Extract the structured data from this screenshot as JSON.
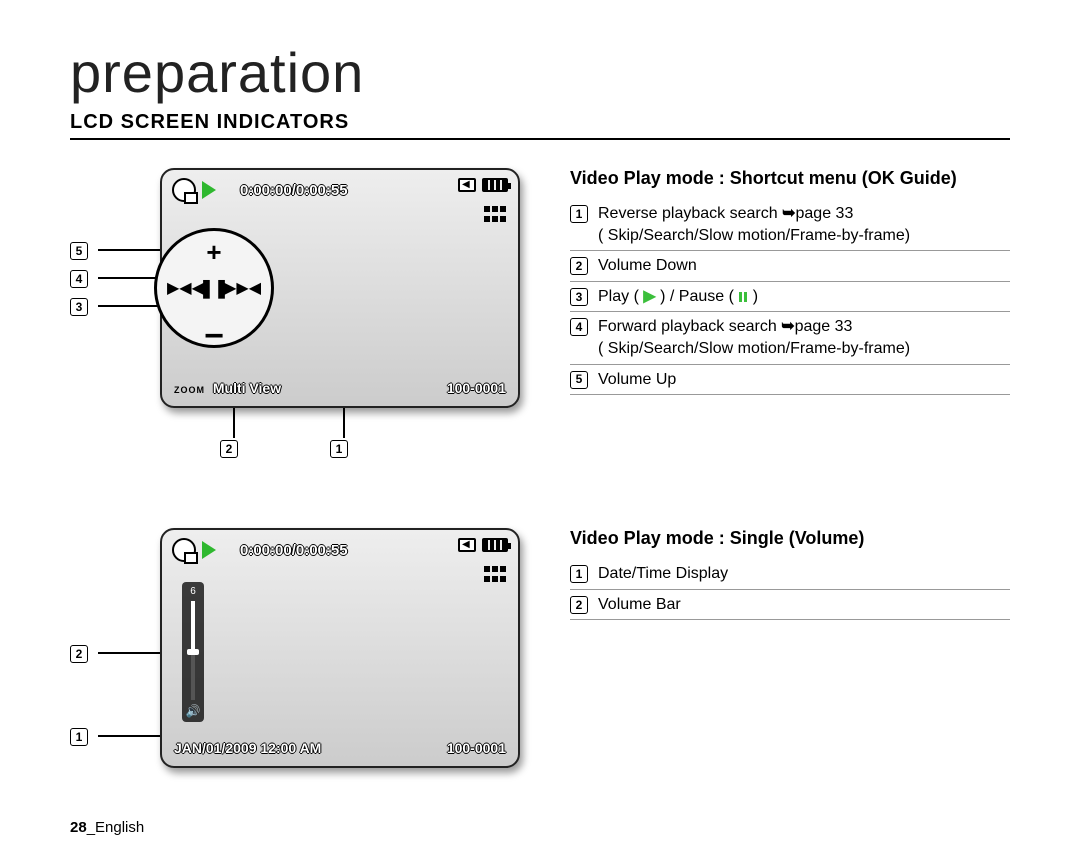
{
  "chapter": "preparation",
  "section": "LCD SCREEN INDICATORS",
  "block1": {
    "title": "Video Play mode : Shortcut menu (OK Guide)",
    "screen": {
      "timecode": "0:00:00/0:00:55",
      "zoom_prefix": "ZOOM",
      "multi_view": "Multi View",
      "file_no": "100-0001"
    },
    "callouts": {
      "c5": "5",
      "c4": "4",
      "c3": "3",
      "c2": "2",
      "c1": "1"
    },
    "items": [
      {
        "n": "1",
        "text": "Reverse playback search ➥page 33\n( Skip/Search/Slow motion/Frame-by-frame)"
      },
      {
        "n": "2",
        "text": "Volume Down"
      },
      {
        "n": "3",
        "text": "Play ( ▶ ) / Pause ( ❚❚ )",
        "has_icons": true
      },
      {
        "n": "4",
        "text": "Forward playback search ➥page 33\n( Skip/Search/Slow motion/Frame-by-frame)"
      },
      {
        "n": "5",
        "text": "Volume Up"
      }
    ]
  },
  "block2": {
    "title": "Video Play mode : Single (Volume)",
    "screen": {
      "timecode": "0:00:00/0:00:55",
      "datetime": "JAN/01/2009 12:00 AM",
      "file_no": "100-0001",
      "vol_level": "6"
    },
    "callouts": {
      "c2": "2",
      "c1": "1"
    },
    "items": [
      {
        "n": "1",
        "text": "Date/Time Display"
      },
      {
        "n": "2",
        "text": "Volume Bar"
      }
    ]
  },
  "footer": {
    "page": "28",
    "sep": "_",
    "lang": "English"
  }
}
